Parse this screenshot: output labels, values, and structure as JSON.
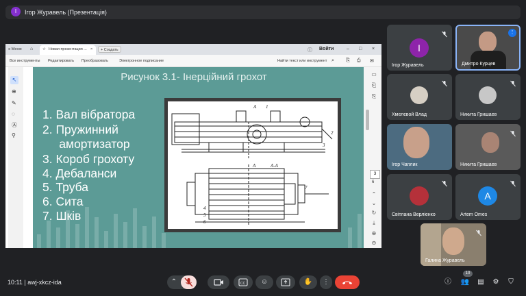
{
  "presenter": {
    "avatar_letter": "І",
    "title": "Ігор Журавель (Презентація)"
  },
  "window": {
    "menu_label": "Меню",
    "tab_label": "Новая презентация ...",
    "create_label": "Создать",
    "login_label": "Войти",
    "toolbar": [
      "Все инструменты",
      "Редактировать",
      "Преобразовать",
      "Электронное подписание"
    ],
    "search_tools": "Найти текст или инструмент",
    "page_current": "3",
    "page_total": "6"
  },
  "slide": {
    "title": "Рисунок 3.1- Інерційний грохот",
    "items": [
      "1.  Вал вібратора",
      "2.  Пружинний",
      "     амортизатор",
      "3.  Короб грохоту",
      "4.  Дебаланси",
      "5.  Труба",
      "6.  Сита",
      "7.  Шків"
    ],
    "drawing_labels": {
      "a1": "А",
      "one": "1",
      "two": "2",
      "three": "3",
      "aa": "А-А",
      "a2": "А",
      "four": "4",
      "five": "5",
      "six": "6",
      "seven": "7"
    }
  },
  "participants": [
    {
      "name": "Ігор Журавель",
      "letter": "І",
      "color": "#8e24aa"
    },
    {
      "name": "Дмитро Курцев"
    },
    {
      "name": "Хмелєвой Влад"
    },
    {
      "name": "Никита Гришаев"
    },
    {
      "name": "Ігор Чаплик"
    },
    {
      "name": "Никита Гришаев"
    },
    {
      "name": "Світлана Верліенко"
    },
    {
      "name": "Artem Omes",
      "letter": "A",
      "color": "#1e88e5"
    },
    {
      "name": "Галина Журавель"
    }
  ],
  "bottom": {
    "time": "10:11",
    "separator": "|",
    "meeting_code": "awj-xkcz-ida",
    "people_count": "10"
  }
}
